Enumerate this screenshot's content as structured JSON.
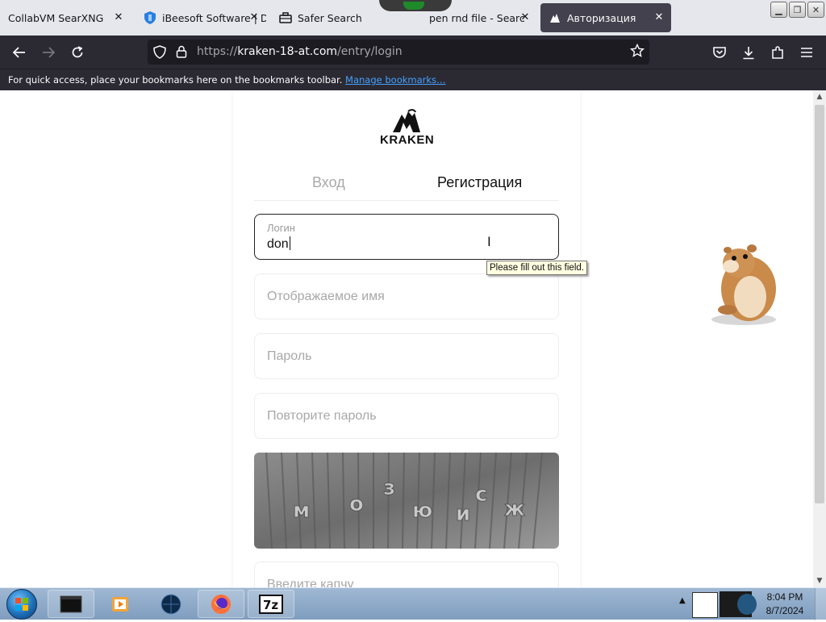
{
  "browser": {
    "tabs": [
      {
        "title": "CollabVM SearXNG",
        "icon": "none"
      },
      {
        "title": "iBeesoft Software | D",
        "icon": "shield-icon"
      },
      {
        "title": "Safer Search",
        "icon": "briefcase-icon"
      },
      {
        "title": "pen rnd file - Searc",
        "icon": "none"
      },
      {
        "title": "Авторизация",
        "icon": "kraken-favicon",
        "active": true
      }
    ],
    "url": {
      "prefix": "https://",
      "host": "kraken-18-at.com",
      "path": "/entry/login"
    },
    "bookmarks_bar": {
      "message": "For quick access, place your bookmarks here on the bookmarks toolbar.",
      "link": "Manage bookmarks…"
    }
  },
  "page": {
    "logo_text": "KRAKEN",
    "tabs": {
      "login": "Вход",
      "register": "Регистрация"
    },
    "form": {
      "login_label": "Логин",
      "login_value": "don",
      "display_name_placeholder": "Отображаемое имя",
      "password_placeholder": "Пароль",
      "repeat_password_placeholder": "Повторите пароль",
      "captcha_placeholder": "Введите капчу",
      "captcha_letters": [
        "м",
        "о",
        "з",
        "ю",
        "и",
        "с",
        "ж"
      ]
    },
    "validation_tooltip": "Please fill out this field."
  },
  "taskbar": {
    "items": [
      "terminal",
      "media-player",
      "browser-globe",
      "firefox",
      "7zip"
    ],
    "clock": {
      "time": "8:04 PM",
      "date": "8/7/2024"
    }
  },
  "colors": {
    "tab_active": "#42414d",
    "nav_bg": "#2b2a33",
    "link": "#45a1ff",
    "tooltip_bg": "#ffffe1"
  }
}
